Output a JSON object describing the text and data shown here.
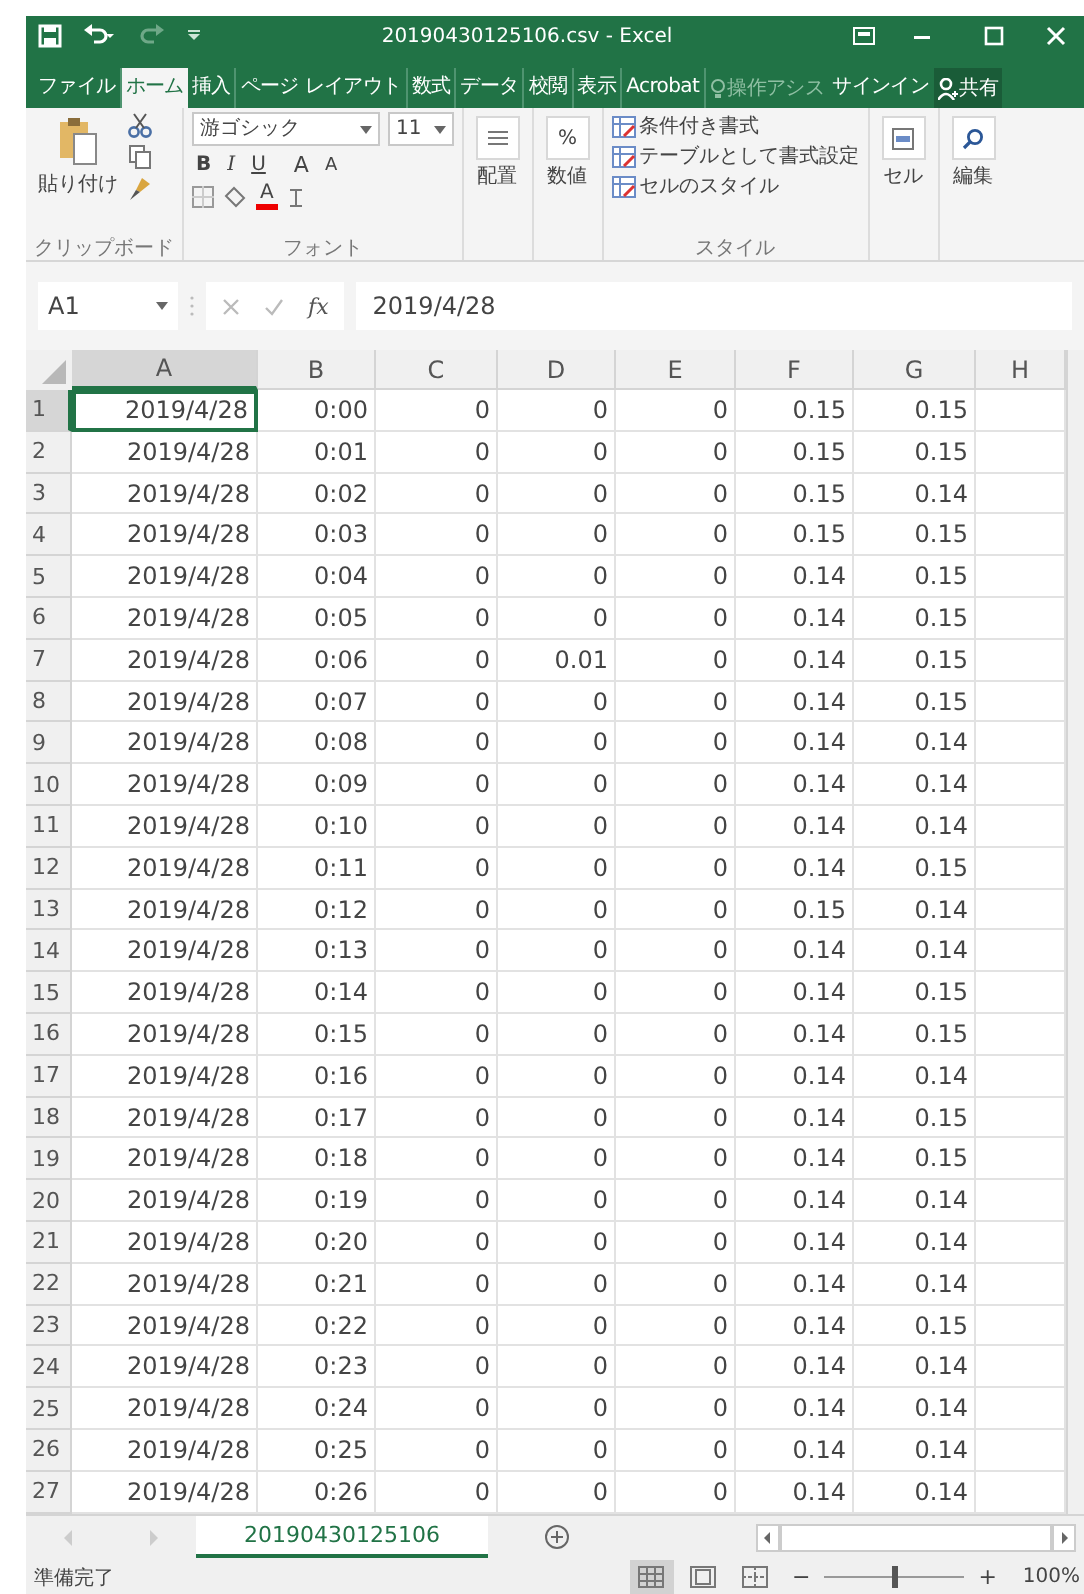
{
  "window": {
    "title": "20190430125106.csv - Excel"
  },
  "ribbon_tabs": [
    {
      "label": "ファイル",
      "selected": false
    },
    {
      "label": "ホーム",
      "selected": true
    },
    {
      "label": "挿入",
      "selected": false
    },
    {
      "label": "ページ レイアウト",
      "selected": false
    },
    {
      "label": "数式",
      "selected": false
    },
    {
      "label": "データ",
      "selected": false
    },
    {
      "label": "校閲",
      "selected": false
    },
    {
      "label": "表示",
      "selected": false
    },
    {
      "label": "Acrobat",
      "selected": false
    }
  ],
  "tell_me": {
    "placeholder": "操作アシス"
  },
  "sign_in": "サインイン",
  "share": "共有",
  "ribbon": {
    "clipboard": {
      "paste": "貼り付け",
      "label": "クリップボード"
    },
    "font": {
      "font_name": "游ゴシック",
      "font_size": "11",
      "bold": "B",
      "italic": "I",
      "underline": "U",
      "grow": "A",
      "shrink": "A",
      "font_color": "A",
      "label": "フォント"
    },
    "alignment": "配置",
    "number": {
      "symbol": "%",
      "label": "数値"
    },
    "styles": {
      "items": [
        "条件付き書式",
        "テーブルとして書式設定",
        "セルのスタイル"
      ],
      "label": "スタイル"
    },
    "cells": "セル",
    "editing": "編集"
  },
  "formula_bar": {
    "name_box": "A1",
    "fx": "fx",
    "value": "2019/4/28"
  },
  "columns": [
    {
      "label": "A",
      "selected": true
    },
    {
      "label": "B",
      "selected": false
    },
    {
      "label": "C",
      "selected": false
    },
    {
      "label": "D",
      "selected": false
    },
    {
      "label": "E",
      "selected": false
    },
    {
      "label": "F",
      "selected": false
    },
    {
      "label": "G",
      "selected": false
    },
    {
      "label": "H",
      "selected": false
    }
  ],
  "rows": [
    {
      "number": "1",
      "selected": true,
      "cells": [
        "2019/4/28",
        "0:00",
        "0",
        "0",
        "0",
        "0.15",
        "0.15"
      ]
    },
    {
      "number": "2",
      "selected": false,
      "cells": [
        "2019/4/28",
        "0:01",
        "0",
        "0",
        "0",
        "0.15",
        "0.15"
      ]
    },
    {
      "number": "3",
      "selected": false,
      "cells": [
        "2019/4/28",
        "0:02",
        "0",
        "0",
        "0",
        "0.15",
        "0.14"
      ]
    },
    {
      "number": "4",
      "selected": false,
      "cells": [
        "2019/4/28",
        "0:03",
        "0",
        "0",
        "0",
        "0.15",
        "0.15"
      ]
    },
    {
      "number": "5",
      "selected": false,
      "cells": [
        "2019/4/28",
        "0:04",
        "0",
        "0",
        "0",
        "0.14",
        "0.15"
      ]
    },
    {
      "number": "6",
      "selected": false,
      "cells": [
        "2019/4/28",
        "0:05",
        "0",
        "0",
        "0",
        "0.14",
        "0.15"
      ]
    },
    {
      "number": "7",
      "selected": false,
      "cells": [
        "2019/4/28",
        "0:06",
        "0",
        "0.01",
        "0",
        "0.14",
        "0.15"
      ]
    },
    {
      "number": "8",
      "selected": false,
      "cells": [
        "2019/4/28",
        "0:07",
        "0",
        "0",
        "0",
        "0.14",
        "0.15"
      ]
    },
    {
      "number": "9",
      "selected": false,
      "cells": [
        "2019/4/28",
        "0:08",
        "0",
        "0",
        "0",
        "0.14",
        "0.14"
      ]
    },
    {
      "number": "10",
      "selected": false,
      "cells": [
        "2019/4/28",
        "0:09",
        "0",
        "0",
        "0",
        "0.14",
        "0.14"
      ]
    },
    {
      "number": "11",
      "selected": false,
      "cells": [
        "2019/4/28",
        "0:10",
        "0",
        "0",
        "0",
        "0.14",
        "0.14"
      ]
    },
    {
      "number": "12",
      "selected": false,
      "cells": [
        "2019/4/28",
        "0:11",
        "0",
        "0",
        "0",
        "0.14",
        "0.15"
      ]
    },
    {
      "number": "13",
      "selected": false,
      "cells": [
        "2019/4/28",
        "0:12",
        "0",
        "0",
        "0",
        "0.15",
        "0.14"
      ]
    },
    {
      "number": "14",
      "selected": false,
      "cells": [
        "2019/4/28",
        "0:13",
        "0",
        "0",
        "0",
        "0.14",
        "0.14"
      ]
    },
    {
      "number": "15",
      "selected": false,
      "cells": [
        "2019/4/28",
        "0:14",
        "0",
        "0",
        "0",
        "0.14",
        "0.15"
      ]
    },
    {
      "number": "16",
      "selected": false,
      "cells": [
        "2019/4/28",
        "0:15",
        "0",
        "0",
        "0",
        "0.14",
        "0.15"
      ]
    },
    {
      "number": "17",
      "selected": false,
      "cells": [
        "2019/4/28",
        "0:16",
        "0",
        "0",
        "0",
        "0.14",
        "0.14"
      ]
    },
    {
      "number": "18",
      "selected": false,
      "cells": [
        "2019/4/28",
        "0:17",
        "0",
        "0",
        "0",
        "0.14",
        "0.15"
      ]
    },
    {
      "number": "19",
      "selected": false,
      "cells": [
        "2019/4/28",
        "0:18",
        "0",
        "0",
        "0",
        "0.14",
        "0.15"
      ]
    },
    {
      "number": "20",
      "selected": false,
      "cells": [
        "2019/4/28",
        "0:19",
        "0",
        "0",
        "0",
        "0.14",
        "0.14"
      ]
    },
    {
      "number": "21",
      "selected": false,
      "cells": [
        "2019/4/28",
        "0:20",
        "0",
        "0",
        "0",
        "0.14",
        "0.14"
      ]
    },
    {
      "number": "22",
      "selected": false,
      "cells": [
        "2019/4/28",
        "0:21",
        "0",
        "0",
        "0",
        "0.14",
        "0.14"
      ]
    },
    {
      "number": "23",
      "selected": false,
      "cells": [
        "2019/4/28",
        "0:22",
        "0",
        "0",
        "0",
        "0.14",
        "0.15"
      ]
    },
    {
      "number": "24",
      "selected": false,
      "cells": [
        "2019/4/28",
        "0:23",
        "0",
        "0",
        "0",
        "0.14",
        "0.14"
      ]
    },
    {
      "number": "25",
      "selected": false,
      "cells": [
        "2019/4/28",
        "0:24",
        "0",
        "0",
        "0",
        "0.14",
        "0.14"
      ]
    },
    {
      "number": "26",
      "selected": false,
      "cells": [
        "2019/4/28",
        "0:25",
        "0",
        "0",
        "0",
        "0.14",
        "0.14"
      ]
    },
    {
      "number": "27",
      "selected": false,
      "cells": [
        "2019/4/28",
        "0:26",
        "0",
        "0",
        "0",
        "0.14",
        "0.14"
      ]
    }
  ],
  "sheet_tabs": [
    {
      "label": "20190430125106",
      "selected": true
    }
  ],
  "status_bar": {
    "status": "準備完了",
    "views": [
      {
        "kind": "normal",
        "selected": true
      },
      {
        "kind": "page-layout",
        "selected": false
      },
      {
        "kind": "page-break",
        "selected": false
      }
    ],
    "zoom_out": "−",
    "zoom_in": "+",
    "zoom": {
      "level": 0.5
    },
    "zoom_text": "100%"
  }
}
